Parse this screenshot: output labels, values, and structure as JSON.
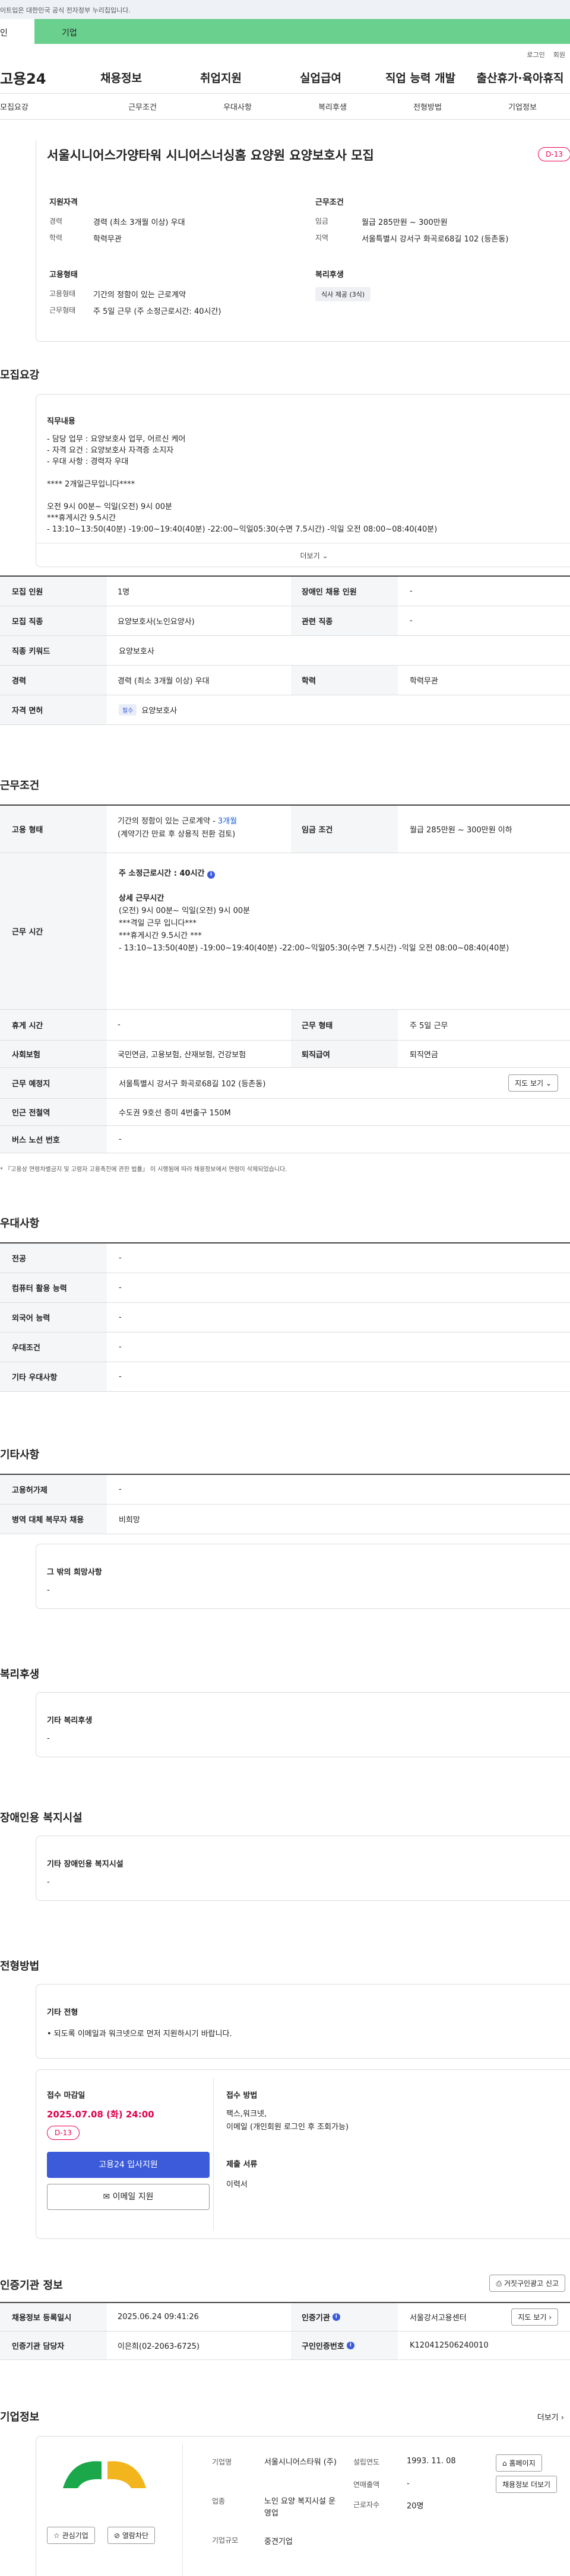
{
  "topbar": {
    "notice": "이트입은 대한민국 공식 전자정부 누리집입니다."
  },
  "usertabs": {
    "personal": "인",
    "company": "기업"
  },
  "util": {
    "login": "로그인",
    "join": "회원"
  },
  "gnb": {
    "logo": "고용24",
    "menu": [
      "채용정보",
      "취업지원",
      "실업급여",
      "직업 능력 개발",
      "출산휴가·육아휴직"
    ]
  },
  "subnav": [
    "모집요강",
    "근무조건",
    "우대사항",
    "복리후생",
    "전형방법",
    "기업정보"
  ],
  "header": {
    "title": "서울시니어스가양타워 시니어스너싱홈 요양원 요양보호사 모집",
    "dday": "D-13",
    "qual_title": "지원자격",
    "career_k": "경력",
    "career_v": "경력 (최소 3개월 이상) 우대",
    "edu_k": "학력",
    "edu_v": "학력무관",
    "cond_title": "근무조건",
    "pay_k": "임금",
    "pay_v": "월급 285만원 ~ 300만원",
    "area_k": "지역",
    "area_v": "서울특별시 강서구 화곡로68길 102 (등촌동)",
    "emp_title": "고용형태",
    "emptype_k": "고용형태",
    "emptype_v": "기간의 정함이 있는 근로계약",
    "work_k": "근무형태",
    "work_v": "주 5일 근무 (주 소정근로시간: 40시간)",
    "welfare_title": "복리후생",
    "welfare_tag": "식사 제공 (3식)"
  },
  "recruit": {
    "title": "모집요강",
    "duty_title": "직무내용",
    "lines": [
      "- 담당 업무 : 요양보호사 업무, 어르신 케어",
      "- 자격 요건 : 요양보호사 자격증 소지자",
      "- 우대 사항 : 경력자 우대",
      "",
      "**** 2개일근무입니다****",
      "",
      "오전 9시 00분~ 익일(오전) 9시 00분",
      "***휴게시간 9.5시간",
      "- 13:10~13:50(40분)  -19:00~19:40(40분) -22:00~익일05:30(수면 7.5시간) -익일 오전 08:00~08:40(40분)"
    ],
    "more": "더보기",
    "rows": [
      {
        "k1": "모집 인원",
        "v1": "1명",
        "k2": "장애인 채용 인원",
        "v2": "-"
      },
      {
        "k1": "모집 직종",
        "v1": "요양보호사(노인요양사)",
        "k2": "관련 직종",
        "v2": "-"
      },
      {
        "k1": "직종 키워드",
        "v1": "요양보호사",
        "k2": "",
        "v2": ""
      },
      {
        "k1": "경력",
        "v1": "경력 (최소 3개월 이상) 우대",
        "k2": "학력",
        "v2": "학력무관"
      },
      {
        "k1": "자격 면허",
        "v1": "요양보호사",
        "k2": "",
        "v2": ""
      }
    ],
    "license_tag": "필수"
  },
  "work": {
    "title": "근무조건",
    "emptype_k": "고용 형태",
    "emptype_v1": "기간의 정함이 있는 근로계약 - ",
    "emptype_v1b": "3개월",
    "emptype_v2": "(계약기간 만료 후 상용직 전환 검토)",
    "pay_k": "임금 조건",
    "pay_v": "월급 285만원 ~ 300만원 이하",
    "hours_k": "근무 시간",
    "hours_lines": [
      "주 소정근로시간 : 40시간",
      "",
      "상세 근무시간",
      "(오전) 9시 00분~ 익일(오전) 9시 00분",
      "***격일 근무 입니다***",
      "***휴게시간 9.5시간 ***",
      "- 13:10~13:50(40분) -19:00~19:40(40분) -22:00~익일05:30(수면 7.5시간) -익일 오전 08:00~08:40(40분)"
    ],
    "rest_k": "휴게 시간",
    "rest_v": "-",
    "worktype_k": "근무 형태",
    "worktype_v": "주 5일 근무",
    "ins_k": "사회보험",
    "ins_v": "국민연금, 고용보험, 산재보험, 건강보험",
    "ret_k": "퇴직급여",
    "ret_v": "퇴직연금",
    "place_k": "근무 예정지",
    "place_v": "서울특별시 강서구 화곡로68길 102 (등촌동)",
    "map_btn": "지도 보기",
    "station_k": "인근 전철역",
    "station_v": "수도권 9호선 증미 4번출구 150M",
    "bus_k": "버스 노선 번호",
    "bus_v": "-",
    "note": "* 『고용상 연령차별금지 및 고령자 고용촉진에 관한 법률』 이 시행됨에 따라 채용정보에서 연령이 삭제되었습니다."
  },
  "pref": {
    "title": "우대사항",
    "rows": [
      {
        "k": "전공",
        "v": "-"
      },
      {
        "k": "컴퓨터 활용 능력",
        "v": "-"
      },
      {
        "k": "외국어 능력",
        "v": "-"
      },
      {
        "k": "우대조건",
        "v": "-"
      },
      {
        "k": "기타 우대사항",
        "v": "-"
      }
    ]
  },
  "etc": {
    "title": "기타사항",
    "rows": [
      {
        "k": "고용허가제",
        "v": "-"
      },
      {
        "k": "병역 대체 복무자 채용",
        "v": "비희망"
      }
    ],
    "box_title": "그 밖의 희망사항",
    "box_v": "-"
  },
  "welfare": {
    "title": "복리후생",
    "box_title": "기타 복리후생",
    "box_v": "-"
  },
  "disability": {
    "title": "장애인용 복지시설",
    "box_title": "기타 장애인용 복지시설",
    "box_v": "-"
  },
  "process": {
    "title": "전형방법",
    "box_title": "기타 전형",
    "box_v": "• 되도록 이메일과 워크넷으로 먼저 지원하시기 바랍니다.",
    "deadline_k": "접수 마감일",
    "deadline_v": "2025.07.08 (화) 24:00",
    "dday": "D-13",
    "apply_btn": "고용24 입사지원",
    "email_btn": "이메일 지원",
    "method_k": "접수 방법",
    "method_v1": "팩스,워크넷,",
    "method_v2": "이메일 (개인회원 로그인 후 조회가능)",
    "docs_k": "제출 서류",
    "docs_v": "이력서"
  },
  "cert": {
    "title": "인증기관 정보",
    "report_btn": "거짓구인광고 신고",
    "r1k1": "채용정보 등록일시",
    "r1v1": "2025.06.24 09:41:26",
    "r1k2": "인증기관",
    "r1v2": "서울강서고용센터",
    "r1btn": "지도 보기",
    "r2k1": "인증기관 담당자",
    "r2v1": "이은희(02-2063-6725)",
    "r2k2": "구인인증번호",
    "r2v2": "K120412506240010"
  },
  "company": {
    "title": "기업정보",
    "more": "더보기",
    "name_k": "기업명",
    "name_v": "서울시니어스타워 (주)",
    "year_k": "설립연도",
    "year_v": "1993. 11. 08",
    "home_btn": "홈페이지",
    "sales_k": "연매출액",
    "sales_v": "-",
    "recruit_btn": "채용정보 더보기",
    "industry_k": "업종",
    "industry_v": "노인 요양 복지시설 운영업",
    "emp_k": "근로자수",
    "emp_v": "20명",
    "size_k": "기업규모",
    "size_v": "중견기업",
    "fav_btn": "관심기업",
    "block_btn": "열람차단",
    "colors": {
      "green": "#1aa84a",
      "yellow": "#f2b51e"
    }
  },
  "accent": {
    "green": "#69d08e",
    "blue": "#3b5bdb",
    "red": "#e0004d"
  }
}
